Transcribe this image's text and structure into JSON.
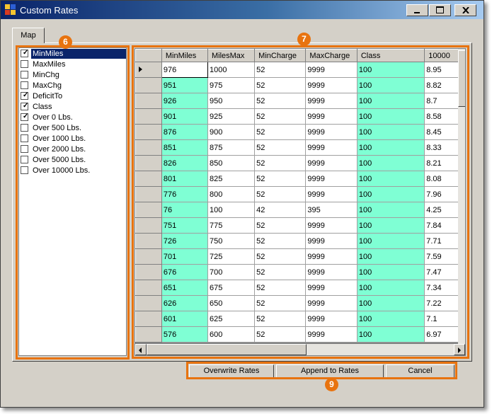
{
  "window": {
    "title": "Custom Rates"
  },
  "tabs": [
    {
      "label": "Map"
    }
  ],
  "checklist": [
    {
      "label": "MinMiles",
      "checked": true,
      "selected": true
    },
    {
      "label": "MaxMiles",
      "checked": false
    },
    {
      "label": "MinChg",
      "checked": false
    },
    {
      "label": "MaxChg",
      "checked": false
    },
    {
      "label": "DeficitTo",
      "checked": true
    },
    {
      "label": "Class",
      "checked": true
    },
    {
      "label": "Over 0 Lbs.",
      "checked": true
    },
    {
      "label": "Over 500 Lbs.",
      "checked": false
    },
    {
      "label": "Over 1000 Lbs.",
      "checked": false
    },
    {
      "label": "Over 2000 Lbs.",
      "checked": false
    },
    {
      "label": "Over 5000 Lbs.",
      "checked": false
    },
    {
      "label": "Over 10000 Lbs.",
      "checked": false
    }
  ],
  "grid": {
    "columns": [
      "MinMiles",
      "MilesMax",
      "MinCharge",
      "MaxCharge",
      "Class",
      "10000"
    ],
    "rows": [
      [
        "976",
        "1000",
        "52",
        "9999",
        "100",
        "8.95"
      ],
      [
        "951",
        "975",
        "52",
        "9999",
        "100",
        "8.82"
      ],
      [
        "926",
        "950",
        "52",
        "9999",
        "100",
        "8.7"
      ],
      [
        "901",
        "925",
        "52",
        "9999",
        "100",
        "8.58"
      ],
      [
        "876",
        "900",
        "52",
        "9999",
        "100",
        "8.45"
      ],
      [
        "851",
        "875",
        "52",
        "9999",
        "100",
        "8.33"
      ],
      [
        "826",
        "850",
        "52",
        "9999",
        "100",
        "8.21"
      ],
      [
        "801",
        "825",
        "52",
        "9999",
        "100",
        "8.08"
      ],
      [
        "776",
        "800",
        "52",
        "9999",
        "100",
        "7.96"
      ],
      [
        "76",
        "100",
        "42",
        "395",
        "100",
        "4.25"
      ],
      [
        "751",
        "775",
        "52",
        "9999",
        "100",
        "7.84"
      ],
      [
        "726",
        "750",
        "52",
        "9999",
        "100",
        "7.71"
      ],
      [
        "701",
        "725",
        "52",
        "9999",
        "100",
        "7.59"
      ],
      [
        "676",
        "700",
        "52",
        "9999",
        "100",
        "7.47"
      ],
      [
        "651",
        "675",
        "52",
        "9999",
        "100",
        "7.34"
      ],
      [
        "626",
        "650",
        "52",
        "9999",
        "100",
        "7.22"
      ],
      [
        "601",
        "625",
        "52",
        "9999",
        "100",
        "7.1"
      ],
      [
        "576",
        "600",
        "52",
        "9999",
        "100",
        "6.97"
      ]
    ]
  },
  "buttons": {
    "overwrite": "Overwrite Rates",
    "append": "Append to Rates",
    "cancel": "Cancel"
  },
  "callouts": {
    "list": "6",
    "grid": "7",
    "buttons": "9"
  },
  "colors": {
    "accent": "#e8730f",
    "highlight_cell": "#7fffd4",
    "selection": "#0a246a"
  }
}
